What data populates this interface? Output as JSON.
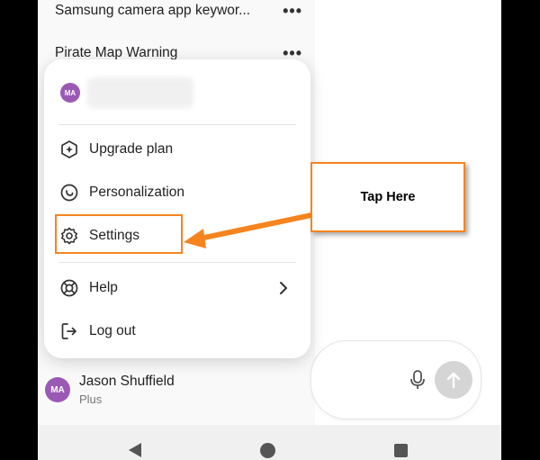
{
  "chat_list": [
    {
      "title": "Samsung camera app keywor..."
    },
    {
      "title": "Pirate Map Warning"
    }
  ],
  "account": {
    "initials": "MA"
  },
  "menu": {
    "upgrade": "Upgrade plan",
    "personalization": "Personalization",
    "settings": "Settings",
    "help": "Help",
    "logout": "Log out"
  },
  "user": {
    "initials": "MA",
    "name": "Jason Shuffield",
    "plan": "Plus"
  },
  "callout": {
    "text": "Tap Here"
  },
  "colors": {
    "accent": "#f5841f",
    "avatar": "#9b59b6"
  },
  "icons": {
    "upgrade": "hexagon-sparkle-icon",
    "personalization": "clock-face-icon",
    "settings": "gear-icon",
    "help": "lifebuoy-icon",
    "logout": "logout-icon",
    "mic": "microphone-icon",
    "send": "arrow-up-icon"
  }
}
